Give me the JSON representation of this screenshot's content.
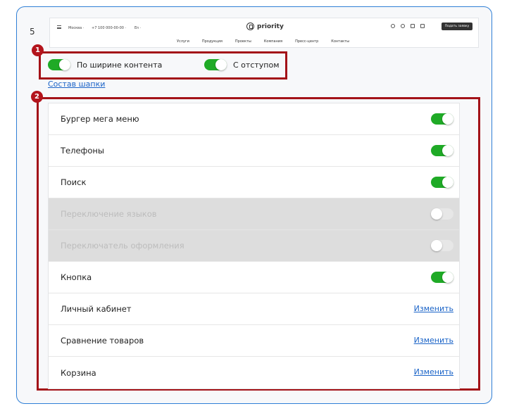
{
  "row": {
    "number": "5"
  },
  "preview": {
    "city": "Москва ·",
    "phone": "+7 100 000-00-00 ·",
    "lang": "En ·",
    "logo": "priority",
    "cta": "Подать заявку",
    "nav": [
      "Услуги",
      "Продукция",
      "Проекты",
      "Компания",
      "Пресс-центр",
      "Контакты"
    ]
  },
  "markers": {
    "first": "1",
    "second": "2"
  },
  "options": {
    "content_width": {
      "label": "По ширине контента",
      "enabled": true
    },
    "indent": {
      "label": "С отступом",
      "enabled": true
    }
  },
  "compose_link": "Состав шапки",
  "items": [
    {
      "label": "Бургер мега меню",
      "control": "toggle",
      "enabled": true,
      "disabled": false
    },
    {
      "label": "Телефоны",
      "control": "toggle",
      "enabled": true,
      "disabled": false
    },
    {
      "label": "Поиск",
      "control": "toggle",
      "enabled": true,
      "disabled": false
    },
    {
      "label": "Переключение языков",
      "control": "toggle",
      "enabled": false,
      "disabled": true
    },
    {
      "label": "Переключатель оформления",
      "control": "toggle",
      "enabled": false,
      "disabled": true
    },
    {
      "label": "Кнопка",
      "control": "toggle",
      "enabled": true,
      "disabled": false
    },
    {
      "label": "Личный кабинет",
      "control": "link",
      "link_label": "Изменить",
      "disabled": false
    },
    {
      "label": "Сравнение товаров",
      "control": "link",
      "link_label": "Изменить",
      "disabled": false
    },
    {
      "label": "Корзина",
      "control": "link",
      "link_label": "Изменить",
      "disabled": false
    }
  ],
  "colors": {
    "accent": "#2f7fd6",
    "toggle_on": "#1faa26",
    "marker": "#b3141c",
    "link": "#1b64c8"
  }
}
